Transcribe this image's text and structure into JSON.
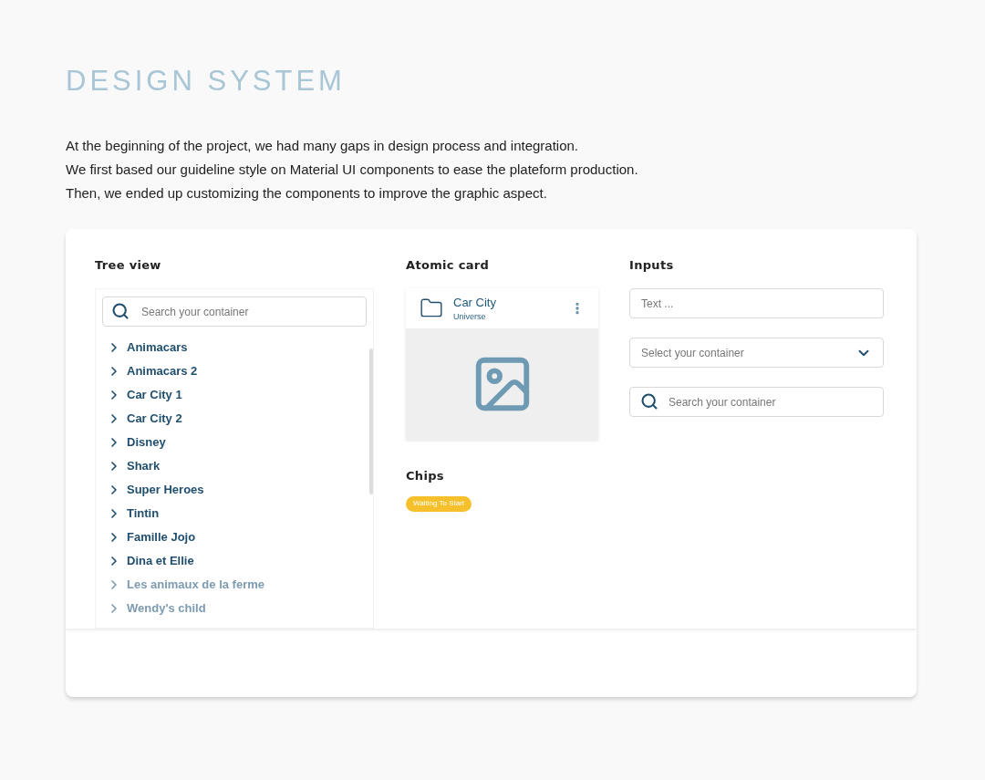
{
  "title": "DESIGN SYSTEM",
  "intro": [
    "At the beginning of the project, we had many gaps in design process and integration.",
    "We first based our guideline style on Material UI components to ease the plateform production.",
    "Then, we ended up customizing the components to improve the graphic aspect."
  ],
  "tree_view": {
    "heading": "Tree view",
    "search": {
      "placeholder": "Search your container"
    },
    "items": [
      {
        "label": "Animacars",
        "faded": false
      },
      {
        "label": "Animacars 2",
        "faded": false
      },
      {
        "label": "Car City 1",
        "faded": false
      },
      {
        "label": "Car City 2",
        "faded": false
      },
      {
        "label": "Disney",
        "faded": false
      },
      {
        "label": "Shark",
        "faded": false
      },
      {
        "label": "Super Heroes",
        "faded": false
      },
      {
        "label": "Tintin",
        "faded": false
      },
      {
        "label": "Famille Jojo",
        "faded": false
      },
      {
        "label": "Dina et Ellie",
        "faded": false
      },
      {
        "label": "Les animaux de la ferme",
        "faded": true
      },
      {
        "label": "Wendy's child",
        "faded": true
      }
    ]
  },
  "atomic_card": {
    "heading": "Atomic card",
    "title": "Car City",
    "subtitle": "Universe"
  },
  "chips": {
    "heading": "Chips",
    "items": [
      {
        "label": "Waiting To Start",
        "color": "#f5c02c"
      }
    ]
  },
  "inputs": {
    "heading": "Inputs",
    "fields": [
      {
        "kind": "text",
        "placeholder": "Text ..."
      },
      {
        "kind": "select",
        "placeholder": "Select your container"
      },
      {
        "kind": "search",
        "placeholder": "Search your container"
      }
    ]
  }
}
